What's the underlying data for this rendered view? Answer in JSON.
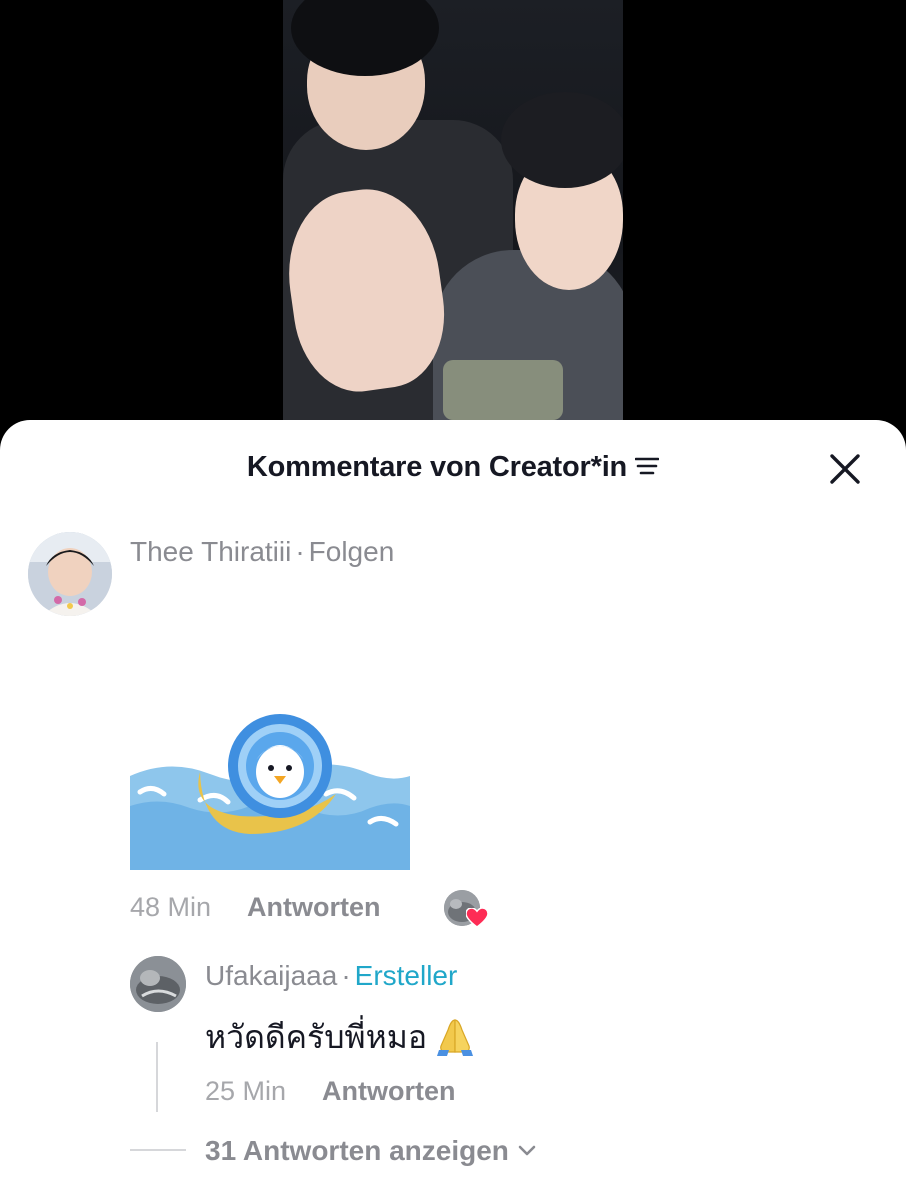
{
  "video": {
    "background": "#000000"
  },
  "sheet": {
    "title": "Kommentare von Creator*in",
    "filter_icon": "filter-lines-icon",
    "close_icon": "close-icon"
  },
  "comment": {
    "username": "Thee Thiratiii",
    "separator": "·",
    "follow_label": "Folgen",
    "sticker": "penguin-coin-sticker",
    "time": "48 Min",
    "reply_label": "Antworten",
    "liked_by_creator": true
  },
  "reply": {
    "username": "Ufakaijaaa",
    "separator": "·",
    "role_badge": "Ersteller",
    "text": "หวัดดีครับพี่หมอ",
    "emoji": "pray-icon",
    "time": "25 Min",
    "reply_label": "Antworten"
  },
  "view_replies": {
    "label": "31 Antworten anzeigen"
  },
  "colors": {
    "accent_creator": "#20a7c9",
    "heart": "#fe2c55",
    "secondary_text": "#8a8b91",
    "primary_text": "#161823"
  }
}
